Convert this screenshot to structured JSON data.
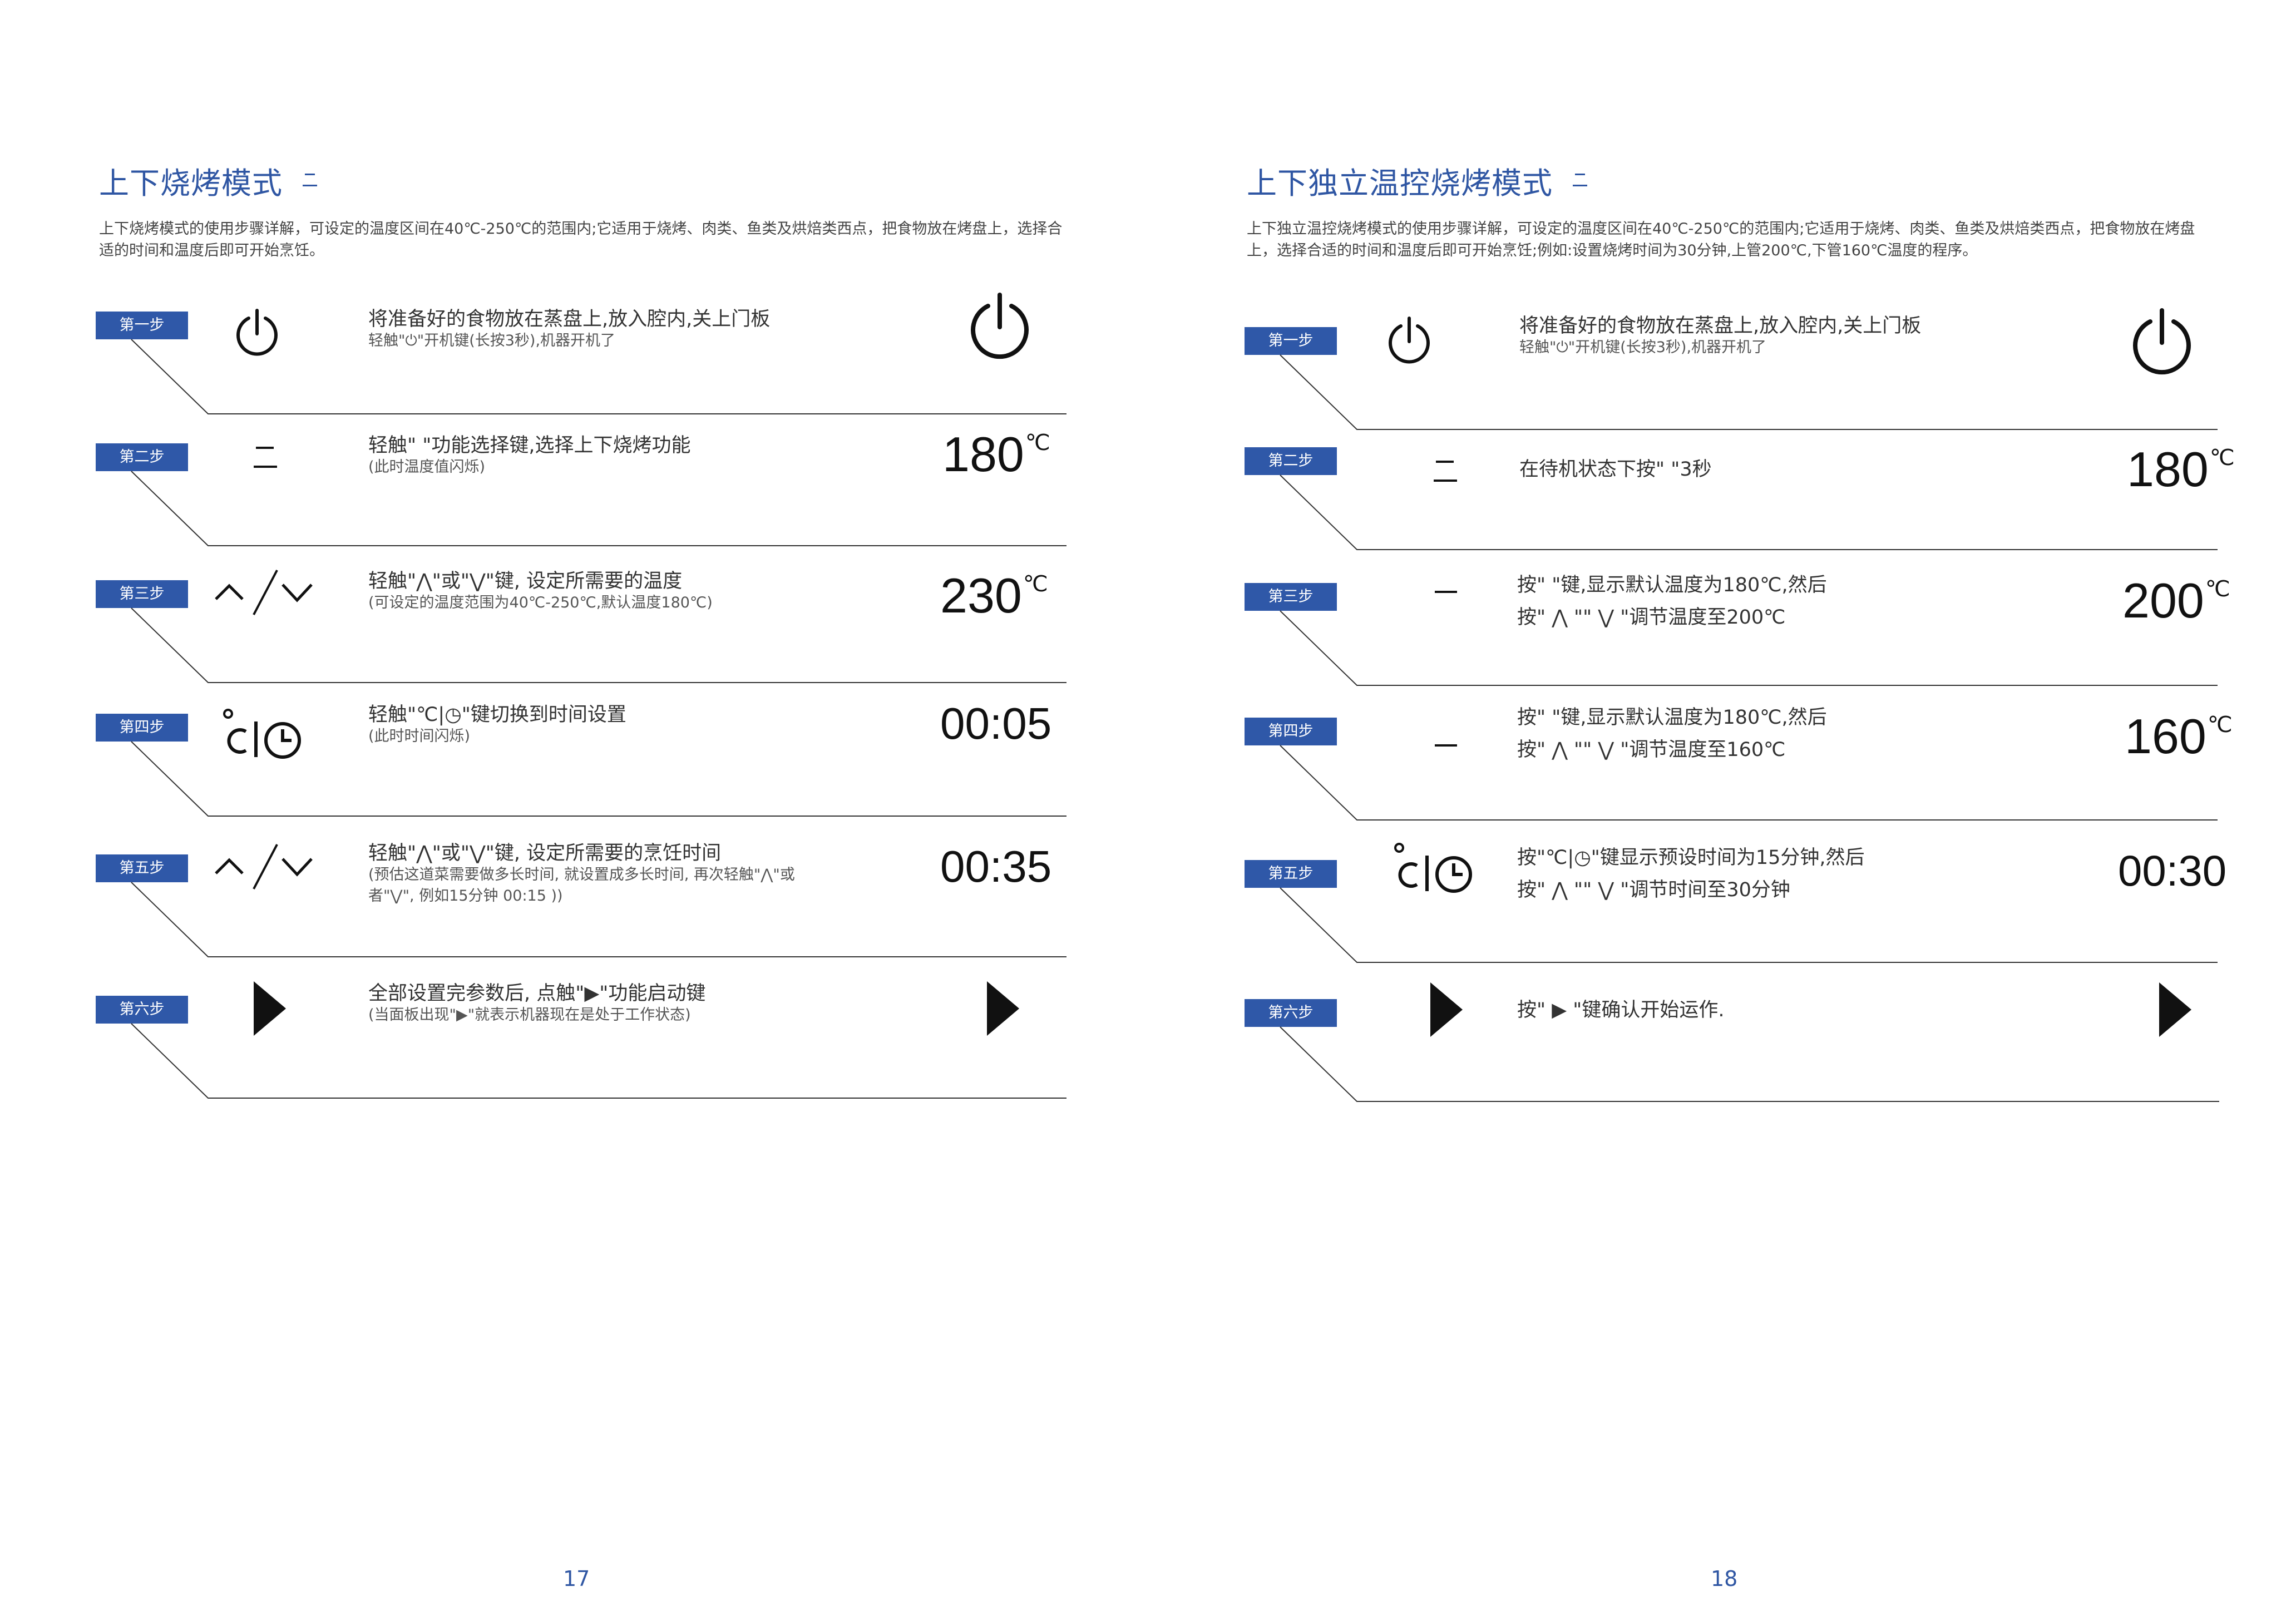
{
  "left": {
    "title": "上下烧烤模式",
    "description": "上下烧烤模式的使用步骤详解，可设定的温度区间在40℃-250℃的范围内;它适用于烧烤、肉类、鱼类及烘焙类西点，把食物放在烤盘上，选择合适的时间和温度后即可开始烹饪。",
    "page_number": "17",
    "steps": [
      {
        "badge": "第一步",
        "line1": "将准备好的食物放在蒸盘上,放入腔内,关上门板",
        "line2": "轻触\"⏻\"开机键(长按3秒),机器开机了",
        "display": "",
        "icon": "power-icon"
      },
      {
        "badge": "第二步",
        "line1": "轻触\" \"功能选择键,选择上下烧烤功能",
        "line2": "(此时温度值闪烁)",
        "display": "180",
        "unit": "℃",
        "icon": "upper-lower-heat-icon"
      },
      {
        "badge": "第三步",
        "line1": "轻触\"⋀\"或\"⋁\"键, 设定所需要的温度",
        "line2": "(可设定的温度范围为40℃-250℃,默认温度180℃)",
        "display": "230",
        "unit": "℃",
        "icon": "up-down-adjust-icon"
      },
      {
        "badge": "第四步",
        "line1": "轻触\"℃|◷\"键切换到时间设置",
        "line2": "(此时时间闪烁)",
        "display": "00:05",
        "icon": "temp-time-toggle-icon"
      },
      {
        "badge": "第五步",
        "line1": "轻触\"⋀\"或\"⋁\"键, 设定所需要的烹饪时间",
        "line2": "(预估这道菜需要做多长时间, 就设置成多长时间, 再次轻触\"⋀\"或",
        "line3": "者\"⋁\", 例如15分钟 00:15 ))",
        "display": "00:35",
        "icon": "up-down-adjust-icon"
      },
      {
        "badge": "第六步",
        "line1": "全部设置完参数后, 点触\"▶\"功能启动键",
        "line2": "(当面板出现\"▶\"就表示机器现在是处于工作状态)",
        "display": "",
        "icon": "start-icon"
      }
    ]
  },
  "right": {
    "title": "上下独立温控烧烤模式",
    "description": "上下独立温控烧烤模式的使用步骤详解，可设定的温度区间在40℃-250℃的范围内;它适用于烧烤、肉类、鱼类及烘焙类西点，把食物放在烤盘上，选择合适的时间和温度后即可开始烹饪;例如:设置烧烤时间为30分钟,上管200℃,下管160℃温度的程序。",
    "page_number": "18",
    "steps": [
      {
        "badge": "第一步",
        "line1": "将准备好的食物放在蒸盘上,放入腔内,关上门板",
        "line2": "轻触\"⏻\"开机键(长按3秒),机器开机了",
        "display": "",
        "icon": "power-icon"
      },
      {
        "badge": "第二步",
        "line1": "在待机状态下按\" \"3秒",
        "display": "180",
        "unit": "℃",
        "icon": "upper-lower-heat-icon"
      },
      {
        "badge": "第三步",
        "line1": "按\" \"键,显示默认温度为180℃,然后",
        "line2": "按\" ⋀ \"\" ⋁ \"调节温度至200℃",
        "display": "200",
        "unit": "℃",
        "icon": "upper-heat-icon"
      },
      {
        "badge": "第四步",
        "line1": "按\" \"键,显示默认温度为180℃,然后",
        "line2": "按\" ⋀ \"\" ⋁ \"调节温度至160℃",
        "display": "160",
        "unit": "℃",
        "icon": "lower-heat-icon"
      },
      {
        "badge": "第五步",
        "line1": "按\"℃|◷\"键显示预设时间为15分钟,然后",
        "line2": "按\" ⋀ \"\" ⋁ \"调节时间至30分钟",
        "display": "00:30",
        "icon": "temp-time-toggle-icon"
      },
      {
        "badge": "第六步",
        "line1": "按\" ▶ \"键确认开始运作.",
        "display": "",
        "icon": "start-icon"
      }
    ]
  }
}
